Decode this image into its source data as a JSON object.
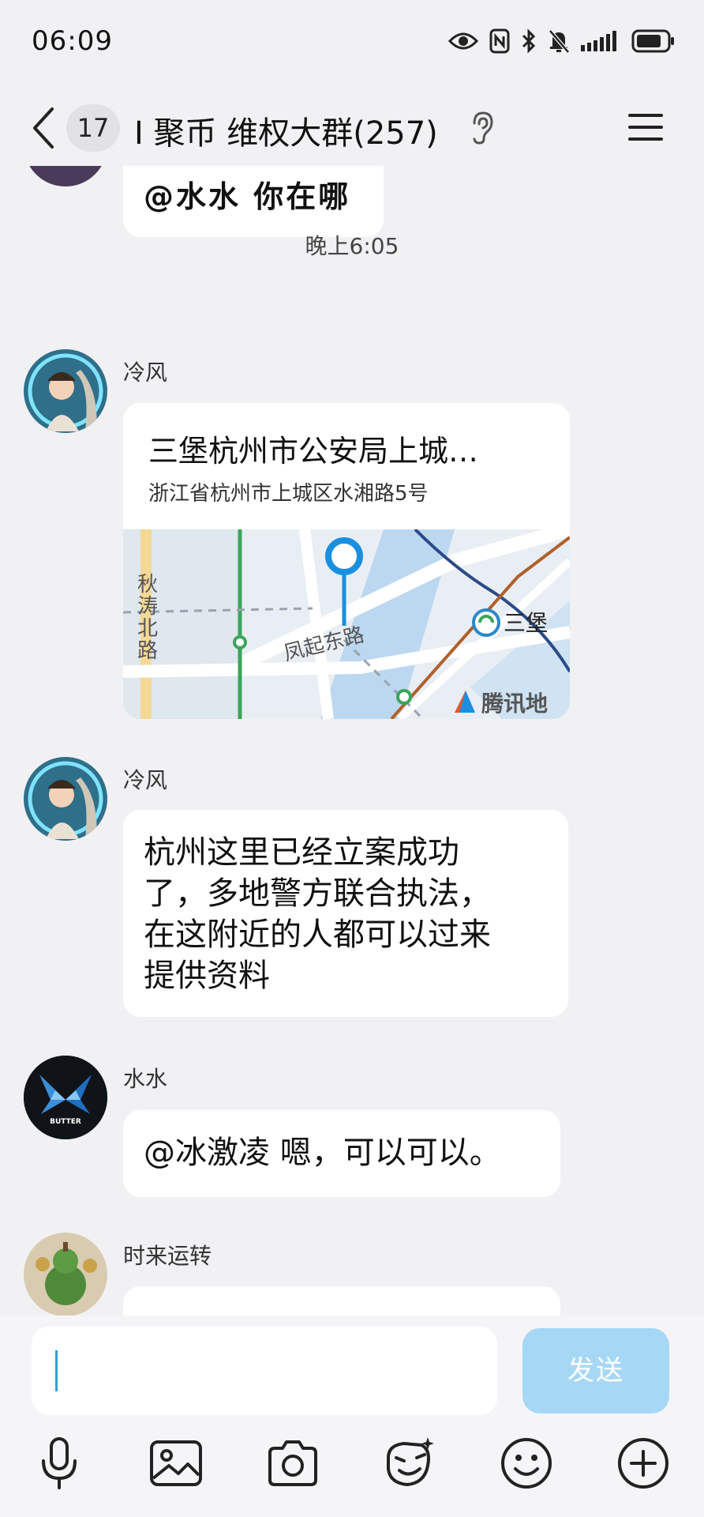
{
  "status_bar": {
    "time": "06:09",
    "icons": [
      "eye-icon",
      "nfc-icon",
      "bluetooth-icon",
      "mute-bell-icon",
      "signal-icon",
      "battery-icon"
    ]
  },
  "header": {
    "unread_count": "17",
    "title": "I 聚币 维权大群(257)",
    "icons": [
      "back-chevron-icon",
      "ear-icon",
      "menu-icon"
    ]
  },
  "messages": {
    "prev_bubble_text": "@水水 你在哪",
    "timestamp": "晚上6:05",
    "location_msg": {
      "sender": "冷风",
      "place_title": "三堡杭州市公安局上城…",
      "address": "浙江省杭州市上城区水湘路5号",
      "map": {
        "label_qiutao": "秋涛北路",
        "label_fengqi": "凤起东路",
        "label_sanbao": "三堡",
        "provider": "腾讯地"
      }
    },
    "text_msg_1": {
      "sender": "冷风",
      "lines": [
        "杭州这里已经立案成功",
        "了，多地警方联合执法，",
        "在这附近的人都可以过来",
        "提供资料"
      ]
    },
    "text_msg_2": {
      "sender": "水水",
      "avatar_text": "BUTTER",
      "text": "@冰激凌 嗯，可以可以。"
    },
    "text_msg_3": {
      "sender": "时来运转"
    }
  },
  "input_bar": {
    "send_label": "发送",
    "tools": [
      "microphone-icon",
      "image-icon",
      "camera-icon",
      "sticker-icon",
      "emoji-icon",
      "plus-icon"
    ]
  },
  "colors": {
    "background": "#f1f1f4",
    "bubble": "#ffffff",
    "send_button": "#a6d8f5",
    "caret": "#2aa3d3",
    "map_pin": "#1a8fe0"
  }
}
